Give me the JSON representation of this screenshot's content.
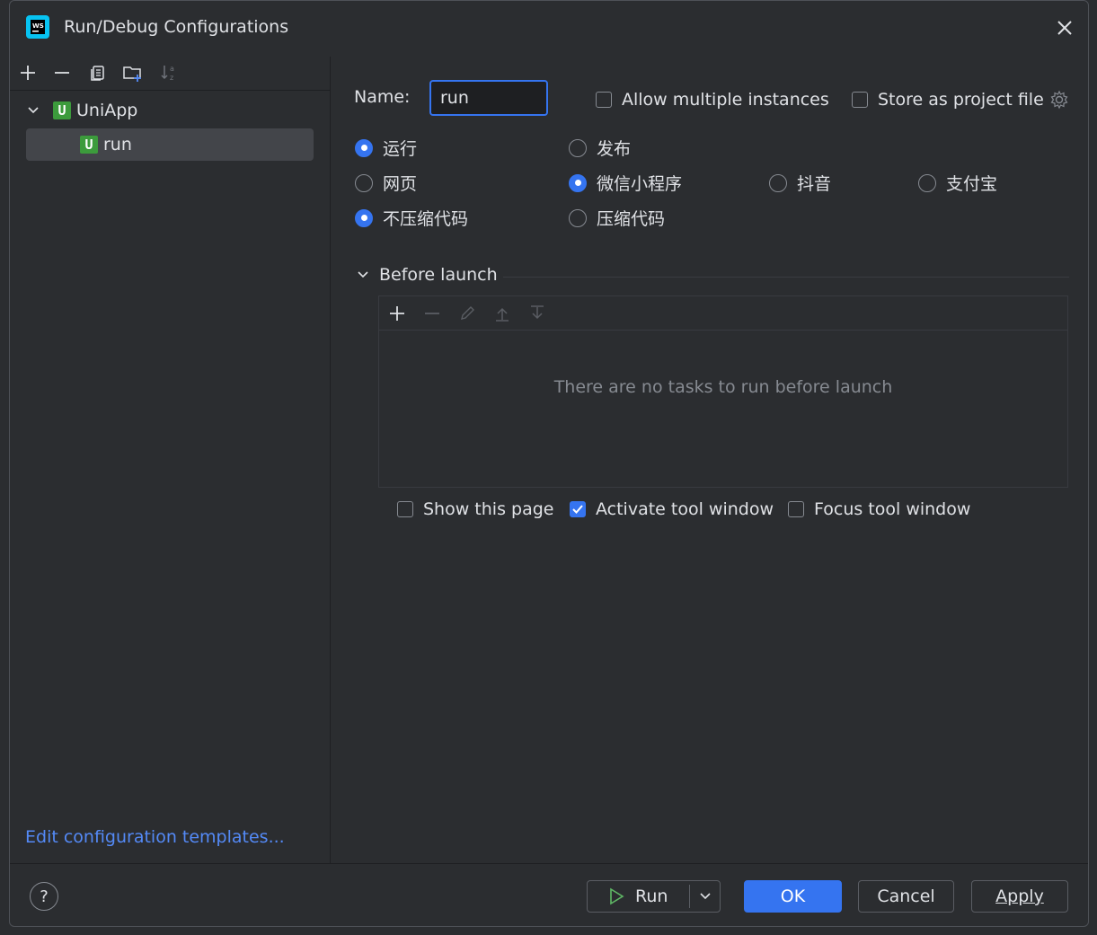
{
  "window": {
    "title": "Run/Debug Configurations"
  },
  "left": {
    "tree": [
      {
        "label": "UniApp",
        "expanded": true
      },
      {
        "label": "run",
        "selected": true
      }
    ],
    "edit_templates": "Edit configuration templates..."
  },
  "right": {
    "name_label": "Name:",
    "name_value": "run",
    "allow_multiple": {
      "label": "Allow multiple instances",
      "checked": false
    },
    "store_as_project": {
      "label": "Store as project file",
      "checked": false
    },
    "radios": {
      "run": "运行",
      "publish": "发布",
      "web": "网页",
      "wechat": "微信小程序",
      "douyin": "抖音",
      "alipay": "支付宝",
      "no_compress": "不压缩代码",
      "compress": "压缩代码"
    },
    "before_launch": {
      "title": "Before launch",
      "empty_text": "There are no tasks to run before launch"
    },
    "options": {
      "show_page": "Show this page",
      "activate_tool": "Activate tool window",
      "focus_tool": "Focus tool window"
    }
  },
  "buttons": {
    "help": "?",
    "run": "Run",
    "ok": "OK",
    "cancel": "Cancel",
    "apply": "Apply"
  },
  "colors": {
    "accent": "#3574f0",
    "link": "#548af7",
    "bg": "#2b2d30",
    "uniapp_icon": "#3c9b3c"
  }
}
